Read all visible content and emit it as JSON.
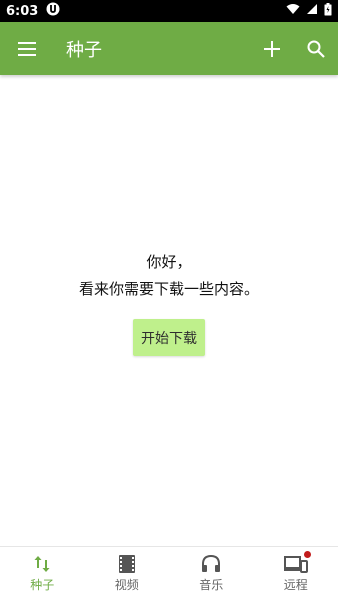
{
  "status_bar": {
    "time": "6:03",
    "app_badge_icon": "torrent-app-icon",
    "icons": [
      "wifi-icon",
      "signal-icon",
      "battery-icon"
    ]
  },
  "app_bar": {
    "title": "种子",
    "menu_icon": "hamburger-menu-icon",
    "actions": [
      "add-icon",
      "search-icon"
    ],
    "color": "#6fac45"
  },
  "empty_state": {
    "greeting": "你好，",
    "message": "看来你需要下载一些内容。",
    "button_label": "开始下载",
    "button_color": "#bff08c"
  },
  "bottom_nav": {
    "items": [
      {
        "label": "种子",
        "icon": "swap-vert-icon",
        "active": true
      },
      {
        "label": "视频",
        "icon": "film-icon",
        "active": false
      },
      {
        "label": "音乐",
        "icon": "headphones-icon",
        "active": false
      },
      {
        "label": "远程",
        "icon": "devices-icon",
        "active": false,
        "badge": true
      }
    ],
    "active_color": "#6fac45"
  }
}
